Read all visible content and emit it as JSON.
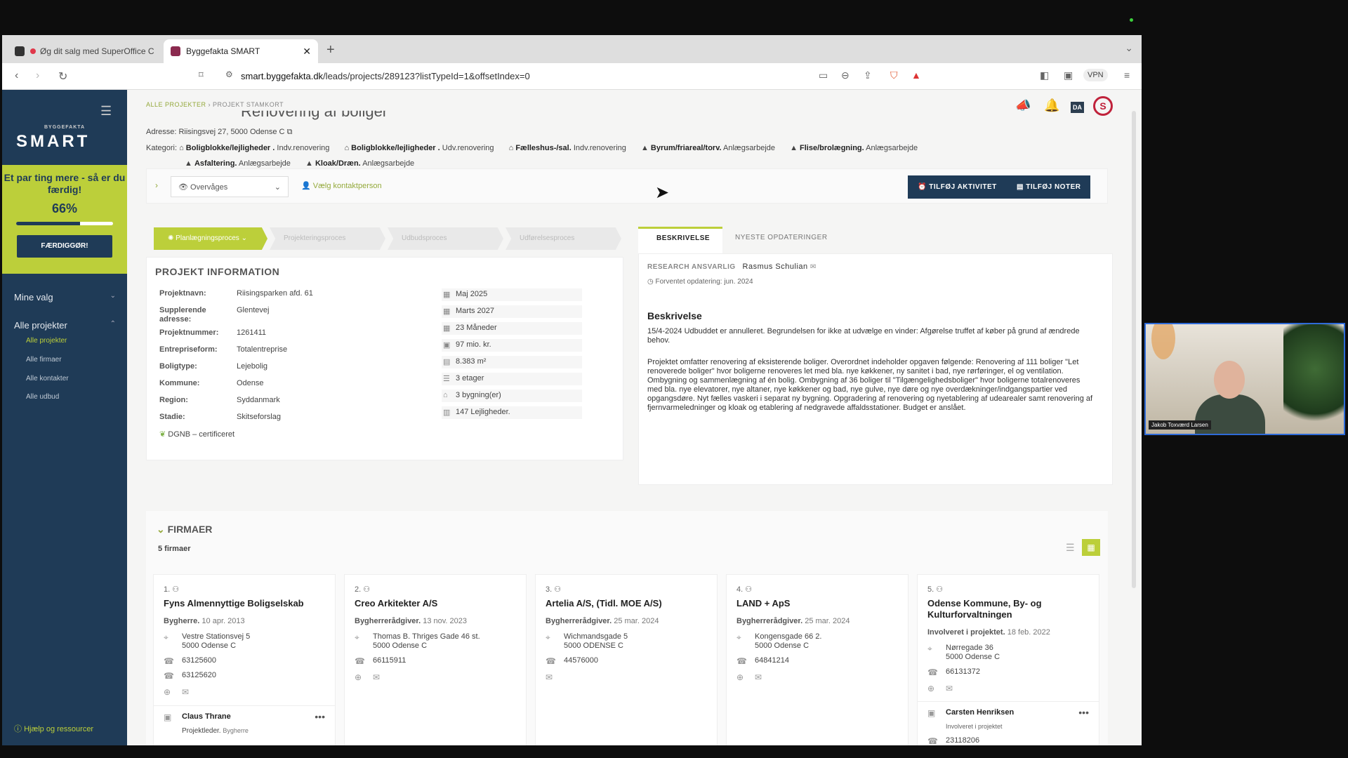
{
  "browser": {
    "tabs": [
      {
        "label": "Øg dit salg med SuperOffice C"
      },
      {
        "label": "Byggefakta SMART"
      }
    ],
    "url_host": "smart.byggefakta.dk",
    "url_path": "/leads/projects/289123?listTypeId=1&offsetIndex=0",
    "vpn_label": "VPN"
  },
  "sidebar": {
    "logo_small": "BYGGEFAKTA",
    "logo": "SMART",
    "promo": {
      "text": "Et par ting mere - så er du færdig!",
      "percent_label": "66%",
      "progress": 0.66,
      "button": "FÆRDIGGØR!"
    },
    "groups": [
      {
        "label": "Mine valg"
      },
      {
        "label": "Alle projekter"
      }
    ],
    "subitems": [
      {
        "label": "Alle projekter"
      },
      {
        "label": "Alle firmaer"
      },
      {
        "label": "Alle kontakter"
      },
      {
        "label": "Alle udbud"
      }
    ],
    "help": "Hjælp og ressourcer"
  },
  "header": {
    "breadcrumb": [
      "ALLE PROJEKTER",
      "PROJEKT STAMKORT"
    ],
    "title": "Renovering af boliger",
    "lang": "DA",
    "address": "Adresse: Riisingsvej 27, 5000 Odense C",
    "categories_label": "Kategori:",
    "categories": [
      {
        "name": "Boligblokke/lejligheder .",
        "type": "Indv.renovering"
      },
      {
        "name": "Boligblokke/lejligheder .",
        "type": "Udv.renovering"
      },
      {
        "name": "Fælleshus-/sal.",
        "type": "Indv.renovering"
      },
      {
        "name": "Byrum/friareal/torv.",
        "type": "Anlægsarbejde"
      },
      {
        "name": "Flise/brolægning.",
        "type": "Anlægsarbejde"
      },
      {
        "name": "Asfaltering.",
        "type": "Anlægsarbejde"
      },
      {
        "name": "Kloak/Dræn.",
        "type": "Anlægsarbejde"
      }
    ]
  },
  "actions": {
    "watch": "Overvåges",
    "contact": "Vælg kontaktperson",
    "add_activity": "TILFØJ AKTIVITET",
    "add_note": "TILFØJ NOTER"
  },
  "stages": [
    {
      "label": "Planlægningsproces"
    },
    {
      "label": "Projekteringsproces"
    },
    {
      "label": "Udbudsproces"
    },
    {
      "label": "Udførelsesproces"
    }
  ],
  "project_info": {
    "title": "PROJEKT INFORMATION",
    "fields": [
      {
        "k": "Projektnavn:",
        "v": "Riisingsparken afd. 61"
      },
      {
        "k": "Supplerende adresse:",
        "v": "Glentevej"
      },
      {
        "k": "Projektnummer:",
        "v": "1261411"
      },
      {
        "k": "Entrepriseform:",
        "v": "Totalentreprise"
      },
      {
        "k": "Boligtype:",
        "v": "Lejebolig"
      },
      {
        "k": "Kommune:",
        "v": "Odense"
      },
      {
        "k": "Region:",
        "v": "Syddanmark"
      },
      {
        "k": "Stadie:",
        "v": "Skitseforslag"
      }
    ],
    "cert": "DGNB – certificeret",
    "facts": [
      "Maj 2025",
      "Marts 2027",
      "23 Måneder",
      "97 mio. kr.",
      "8.383 m²",
      "3 etager",
      "3 bygning(er)",
      "147 Lejligheder."
    ]
  },
  "description": {
    "tabs": [
      "BESKRIVELSE",
      "NYESTE OPDATERINGER"
    ],
    "research_label": "RESEARCH ANSVARLIG",
    "research_name": "Rasmus Schulian",
    "update_label": "Forventet opdatering:",
    "update_value": "jun. 2024",
    "heading": "Beskrivelse",
    "para1": "15/4-2024 Udbuddet er annulleret. Begrundelsen for ikke at udvælge en vinder: Afgørelse truffet af køber på grund af ændrede behov.",
    "para2": "Projektet omfatter renovering af eksisterende boliger. Overordnet indeholder opgaven følgende: Renovering af 111 boliger \"Let renoverede boliger\" hvor boligerne renoveres let med bla. nye køkkener, ny sanitet i bad, nye rørføringer, el og ventilation. Ombygning og sammenlægning af én bolig. Ombygning af 36 boliger til \"Tilgængelighedsboliger\" hvor boligerne totalrenoveres med bla. nye elevatorer, nye altaner, nye køkkener og bad, nye gulve, nye døre og nye overdækninger/indgangspartier ved opgangsdøre. Nyt fælles vaskeri i separat ny bygning. Opgradering af renovering og nyetablering af udearealer samt renovering af fjernvarmeledninger og kloak og etablering af nedgravede affaldsstationer. Budget er anslået."
  },
  "firmer": {
    "title": "FIRMAER",
    "count": "5 firmaer",
    "cards": [
      {
        "num": "1.",
        "name": "Fyns Almennyttige Boligselskab",
        "role": "Bygherre.",
        "date": "10 apr. 2013",
        "addr1": "Vestre Stationsvej 5",
        "addr2": "5000 Odense C",
        "phone1": "63125600",
        "phone2": "63125620",
        "contact": "Claus Thrane",
        "contact_role": "Projektleder.",
        "contact_sub": "Bygherre"
      },
      {
        "num": "2.",
        "name": "Creo Arkitekter A/S",
        "role": "Bygherrerådgiver.",
        "date": "13 nov. 2023",
        "addr1": "Thomas B. Thriges Gade 46 st.",
        "addr2": "5000 Odense C",
        "phone1": "66115911"
      },
      {
        "num": "3.",
        "name": "Artelia A/S, (Tidl. MOE A/S)",
        "role": "Bygherrerådgiver.",
        "date": "25 mar. 2024",
        "addr1": "Wichmandsgade 5",
        "addr2": "5000 ODENSE C",
        "phone1": "44576000"
      },
      {
        "num": "4.",
        "name": "LAND + ApS",
        "role": "Bygherrerådgiver.",
        "date": "25 mar. 2024",
        "addr1": "Kongensgade 66 2.",
        "addr2": "5000 Odense C",
        "phone1": "64841214"
      },
      {
        "num": "5.",
        "name": "Odense Kommune, By- og Kulturforvaltningen",
        "role": "Involveret i projektet.",
        "date": "18 feb. 2022",
        "addr1": "Nørregade 36",
        "addr2": "5000 Odense C",
        "phone1": "66131372",
        "contact": "Carsten Henriksen",
        "contact_role": "Involveret i projektet",
        "phone_partial": "23118206"
      }
    ]
  },
  "video": {
    "name": "Jakob Toxværd Larsen"
  }
}
